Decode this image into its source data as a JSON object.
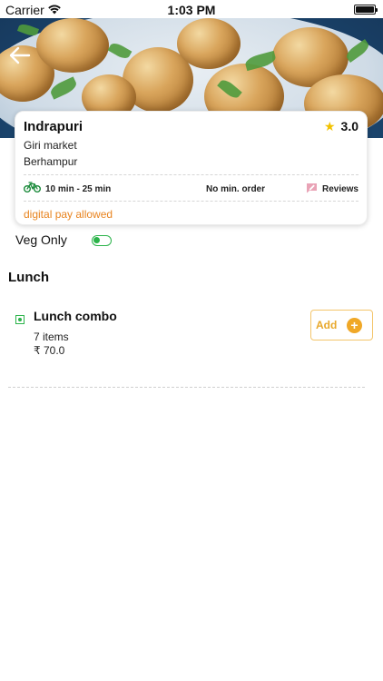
{
  "status_bar": {
    "carrier": "Carrier",
    "time": "1:03 PM"
  },
  "hero": {
    "back_icon": "arrow-left-icon"
  },
  "restaurant": {
    "name": "Indrapuri",
    "rating": "3.0",
    "address_line1": "Giri market",
    "address_line2": "Berhampur",
    "delivery_time": "10 min - 25 min",
    "min_order": "No min. order",
    "reviews_label": "Reviews",
    "payment_note": "digital pay allowed"
  },
  "filters": {
    "veg_only_label": "Veg Only",
    "veg_only_enabled": true
  },
  "menu": {
    "section_title": "Lunch",
    "items": [
      {
        "name": "Lunch combo",
        "count": "7 items",
        "price": "₹ 70.0",
        "add_label": "Add"
      }
    ]
  },
  "colors": {
    "accent_orange": "#e8831e",
    "add_yellow": "#f0a827",
    "veg_green": "#2bb34a",
    "star": "#f2c200"
  }
}
